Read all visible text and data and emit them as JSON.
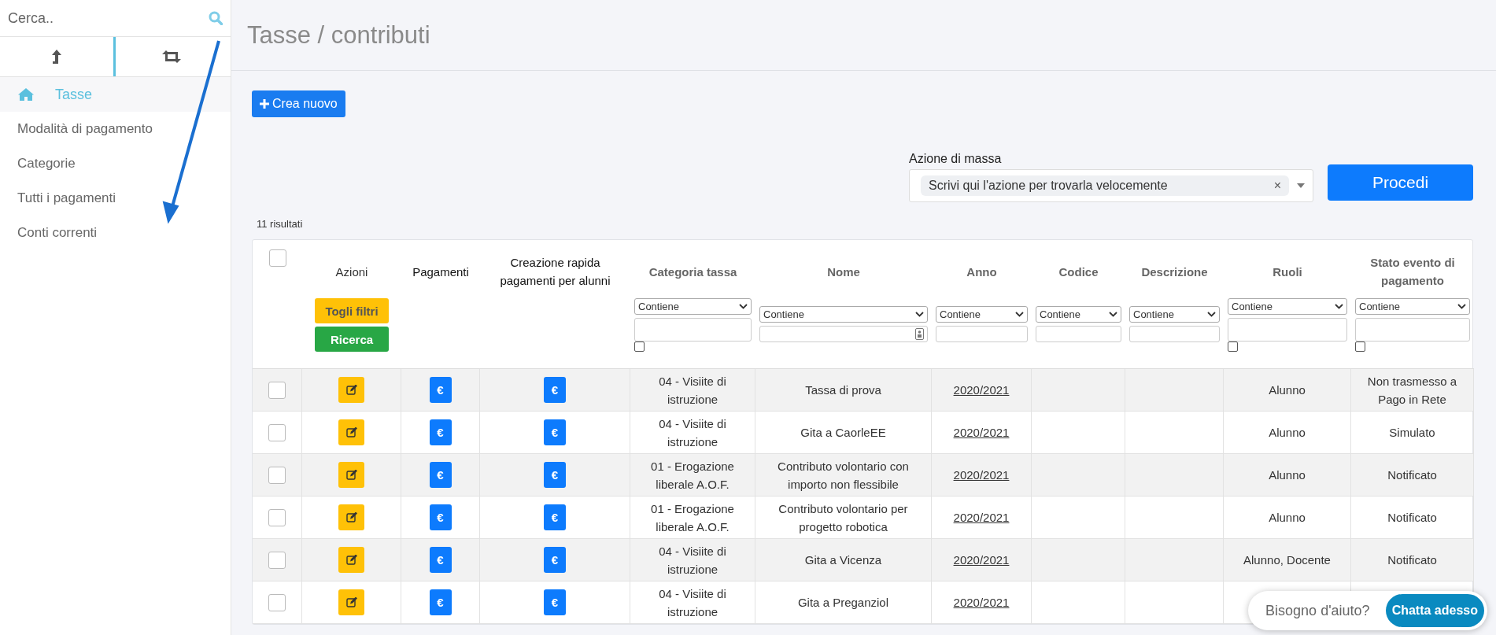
{
  "sidebar": {
    "search": {
      "placeholder": "Cerca.."
    },
    "tabs": [
      {
        "selected": true
      },
      {
        "selected": false
      }
    ],
    "items": [
      {
        "label": "Tasse",
        "selected": true
      },
      {
        "label": "Modalità di pagamento",
        "selected": false
      },
      {
        "label": "Categorie",
        "selected": false
      },
      {
        "label": "Tutti i pagamenti",
        "selected": false
      },
      {
        "label": "Conti correnti",
        "selected": false
      }
    ]
  },
  "page": {
    "title": "Tasse / contributi",
    "create_button": "Crea nuovo",
    "bulk_action": {
      "label": "Azione di massa",
      "value": "Scrivi qui l'azione per trovarla velocemente",
      "clear": "×",
      "button": "Procedi"
    },
    "result_count": "11 risultati"
  },
  "table": {
    "columns": [
      {
        "kind": "check",
        "checked": false
      },
      {
        "kind": "actions",
        "label": "Azioni",
        "buttons": [
          {
            "label": "Togli filtri",
            "kind": "warning"
          },
          {
            "label": "Ricerca",
            "kind": "success"
          }
        ]
      },
      {
        "kind": "plain",
        "label": "Pagamenti"
      },
      {
        "kind": "plain",
        "label": "Creazione rapida pagamenti per alunni"
      },
      {
        "kind": "filter",
        "label": "Categoria tassa",
        "filter": {
          "operator": "Contiene",
          "kind": "area",
          "checked": false
        }
      },
      {
        "kind": "filter",
        "label": "Nome",
        "filter": {
          "operator": "Contiene",
          "kind": "picker"
        }
      },
      {
        "kind": "filter",
        "label": "Anno",
        "filter": {
          "operator": "Contiene",
          "kind": "text"
        }
      },
      {
        "kind": "filter",
        "label": "Codice",
        "filter": {
          "operator": "Contiene",
          "kind": "text"
        }
      },
      {
        "kind": "filter",
        "label": "Descrizione",
        "filter": {
          "operator": "Contiene",
          "kind": "text"
        }
      },
      {
        "kind": "filter",
        "label": "Ruoli",
        "filter": {
          "operator": "Contiene",
          "kind": "area",
          "checked": false
        }
      },
      {
        "kind": "filter",
        "label": "Stato evento di pagamento",
        "filter": {
          "operator": "Contiene",
          "kind": "area",
          "checked": false
        }
      }
    ],
    "rows": [
      {
        "checked": false,
        "payments": "€",
        "quick_payment": "€",
        "category": "04 - Visiite di istruzione",
        "name": "Tassa di prova",
        "year": "2020/2021",
        "roles": "Alunno",
        "status": "Non trasmesso a Pago in Rete"
      },
      {
        "checked": false,
        "payments": "€",
        "quick_payment": "€",
        "category": "04 - Visiite di istruzione",
        "name": "Gita a CaorleEE",
        "year": "2020/2021",
        "roles": "Alunno",
        "status": "Simulato"
      },
      {
        "checked": false,
        "payments": "€",
        "quick_payment": "€",
        "category": "01 - Erogazione liberale A.O.F.",
        "name": "Contributo volontario con importo non flessibile",
        "year": "2020/2021",
        "roles": "Alunno",
        "status": "Notificato"
      },
      {
        "checked": false,
        "payments": "€",
        "quick_payment": "€",
        "category": "01 - Erogazione liberale A.O.F.",
        "name": "Contributo volontario per progetto robotica",
        "year": "2020/2021",
        "roles": "Alunno",
        "status": "Notificato"
      },
      {
        "checked": false,
        "payments": "€",
        "quick_payment": "€",
        "category": "04 - Visiite di istruzione",
        "name": "Gita a Vicenza",
        "year": "2020/2021",
        "roles": "Alunno, Docente",
        "status": "Notificato"
      },
      {
        "checked": false,
        "payments": "€",
        "quick_payment": "€",
        "category": "04 - Visiite di istruzione",
        "name": "Gita a Preganziol",
        "year": "2020/2021"
      }
    ]
  },
  "chat": {
    "prompt": "Bisogno d'aiuto?",
    "button": "Chatta adesso"
  }
}
